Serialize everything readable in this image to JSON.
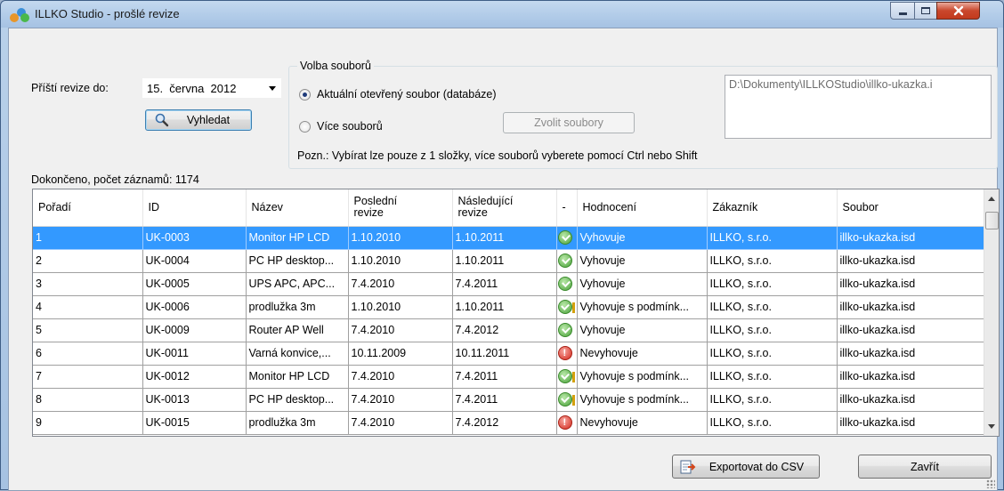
{
  "window": {
    "title": "ILLKO Studio - prošlé revize"
  },
  "filter": {
    "next_revision_label": "Příští revize do:",
    "date_value": "15.  června  2012",
    "search_label": "Vyhledat"
  },
  "file_choice": {
    "legend": "Volba souborů",
    "option_current": "Aktuální otevřený soubor (databáze)",
    "option_multiple": "Více souborů",
    "pick_files_label": "Zvolit soubory",
    "note": "Pozn.: Vybírat lze pouze z 1 složky, více souborů vyberete pomocí Ctrl nebo Shift",
    "path": "D:\\Dokumenty\\ILLKOStudio\\illko-ukazka.i"
  },
  "status_text": "Dokončeno, počet záznamů: 1174",
  "table": {
    "columns": [
      "Pořadí",
      "ID",
      "Název",
      "Poslední\nrevize",
      "Následující\nrevize",
      "-",
      "Hodnocení",
      "Zákazník",
      "Soubor"
    ],
    "rows": [
      {
        "no": "1",
        "id": "UK-0003",
        "name": "Monitor HP LCD",
        "last": "1.10.2010",
        "next": "1.10.2011",
        "icon": "ok-icon",
        "rating": "Vyhovuje",
        "customer": "ILLKO, s.r.o.",
        "file": "illko-ukazka.isd"
      },
      {
        "no": "2",
        "id": "UK-0004",
        "name": "PC HP desktop...",
        "last": "1.10.2010",
        "next": "1.10.2011",
        "icon": "ok-icon",
        "rating": "Vyhovuje",
        "customer": "ILLKO, s.r.o.",
        "file": "illko-ukazka.isd"
      },
      {
        "no": "3",
        "id": "UK-0005",
        "name": "UPS APC, APC...",
        "last": "7.4.2010",
        "next": "7.4.2011",
        "icon": "ok-icon",
        "rating": "Vyhovuje",
        "customer": "ILLKO, s.r.o.",
        "file": "illko-ukazka.isd"
      },
      {
        "no": "4",
        "id": "UK-0006",
        "name": "prodlužka 3m",
        "last": "1.10.2010",
        "next": "1.10.2011",
        "icon": "warn-icon",
        "rating": "Vyhovuje s podmínk...",
        "customer": "ILLKO, s.r.o.",
        "file": "illko-ukazka.isd"
      },
      {
        "no": "5",
        "id": "UK-0009",
        "name": "Router AP Well",
        "last": "7.4.2010",
        "next": "7.4.2012",
        "icon": "ok-icon",
        "rating": "Vyhovuje",
        "customer": "ILLKO, s.r.o.",
        "file": "illko-ukazka.isd"
      },
      {
        "no": "6",
        "id": "UK-0011",
        "name": "Varná konvice,...",
        "last": "10.11.2009",
        "next": "10.11.2011",
        "icon": "bad-icon",
        "rating": "Nevyhovuje",
        "customer": "ILLKO, s.r.o.",
        "file": "illko-ukazka.isd"
      },
      {
        "no": "7",
        "id": "UK-0012",
        "name": "Monitor HP LCD",
        "last": "7.4.2010",
        "next": "7.4.2011",
        "icon": "warn-icon",
        "rating": "Vyhovuje s podmínk...",
        "customer": "ILLKO, s.r.o.",
        "file": "illko-ukazka.isd"
      },
      {
        "no": "8",
        "id": "UK-0013",
        "name": "PC HP desktop...",
        "last": "7.4.2010",
        "next": "7.4.2011",
        "icon": "warn-icon",
        "rating": "Vyhovuje s podmínk...",
        "customer": "ILLKO, s.r.o.",
        "file": "illko-ukazka.isd"
      },
      {
        "no": "9",
        "id": "UK-0015",
        "name": "prodlužka 3m",
        "last": "7.4.2010",
        "next": "7.4.2012",
        "icon": "bad-icon",
        "rating": "Nevyhovuje",
        "customer": "ILLKO, s.r.o.",
        "file": "illko-ukazka.isd"
      }
    ]
  },
  "actions": {
    "export_label": "Exportovat do CSV",
    "close_label": "Zavřít"
  },
  "colors": {
    "selection": "#3399ff",
    "window_frame": "#b9d1ea"
  }
}
